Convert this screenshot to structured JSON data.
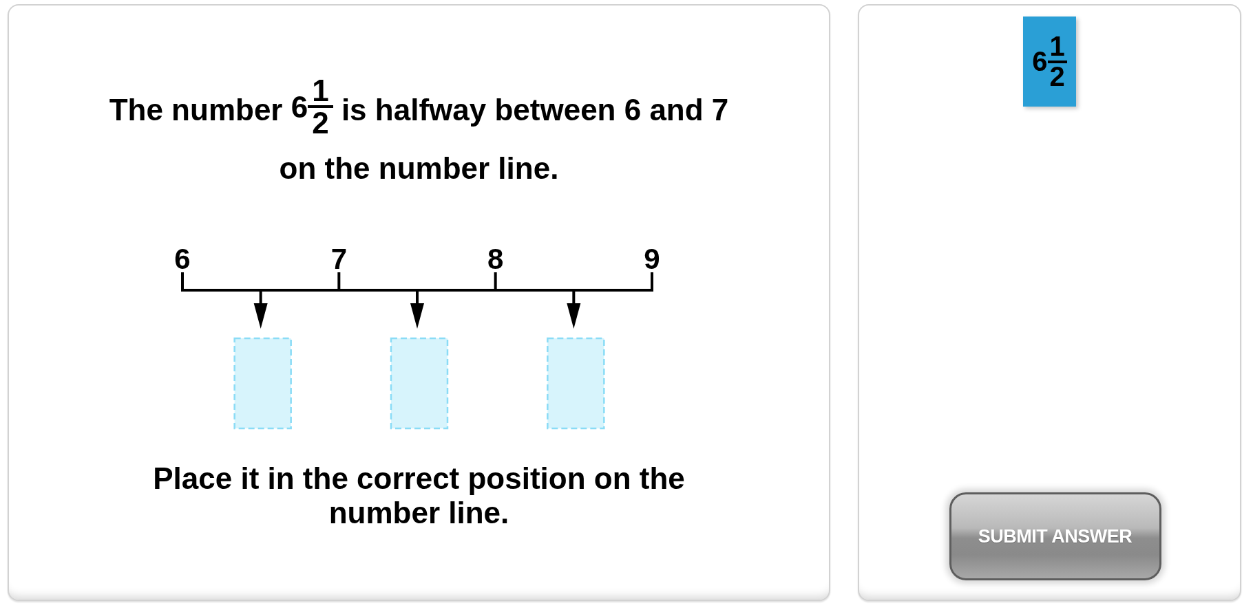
{
  "question": {
    "before": "The number ",
    "number": {
      "whole": "6",
      "numerator": "1",
      "denominator": "2"
    },
    "after": " is halfway between 6 and 7 on the number line."
  },
  "number_line": {
    "labels": [
      "6",
      "7",
      "8",
      "9"
    ]
  },
  "instruction": "Place it in the correct position on the number line.",
  "tile": {
    "whole": "6",
    "numerator": "1",
    "denominator": "2"
  },
  "submit_button": {
    "label": "SUBMIT ANSWER"
  }
}
